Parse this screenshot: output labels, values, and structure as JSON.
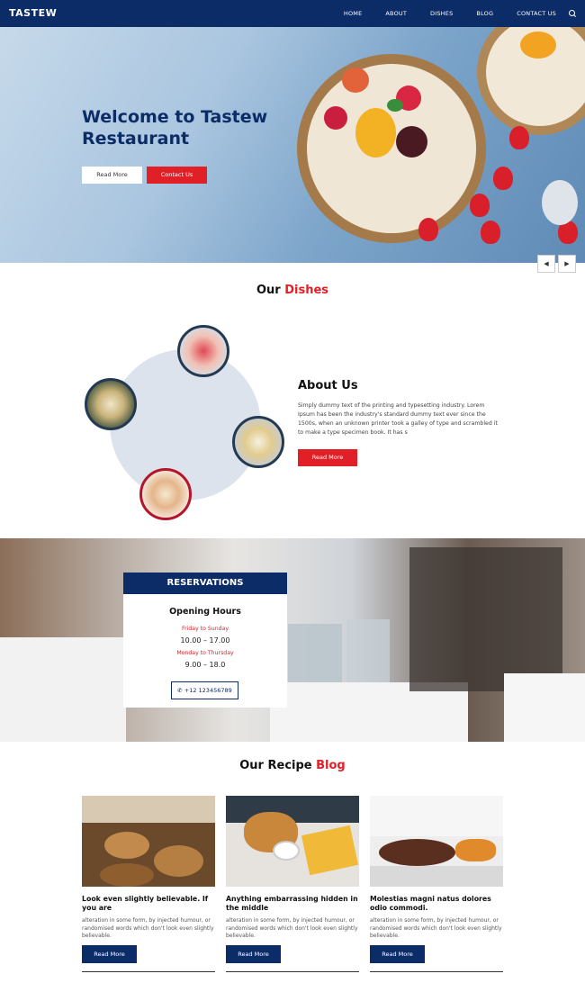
{
  "brand": "TASTEW",
  "nav": {
    "items": [
      "HOME",
      "ABOUT",
      "DISHES",
      "BLOG",
      "CONTACT US"
    ],
    "search_icon": "search-icon"
  },
  "hero": {
    "title": "Welcome to Tastew Restaurant",
    "btn_read_more": "Read More",
    "btn_contact": "Contact Us",
    "prev_icon": "arrow-left-icon",
    "next_icon": "arrow-right-icon"
  },
  "dishes": {
    "title_1": "Our ",
    "title_2": "Dishes"
  },
  "about": {
    "title": "About Us",
    "text": "Simply dummy text of the printing and typesetting industry. Lorem Ipsum has been the industry's standard dummy text ever since the 1500s, when an unknown printer took a galley of type and scrambled it to make a type specimen book. It has s",
    "button": "Read More"
  },
  "reservations": {
    "header": "RESERVATIONS",
    "opening": "Opening Hours",
    "day1": "Friday to Sunday",
    "hours1": "10.00 – 17.00",
    "day2": "Monday to Thursday",
    "hours2": "9.00 – 18.0",
    "phone": "+12 123456789",
    "phone_icon": "phone-icon"
  },
  "blog": {
    "title_1": "Our Recipe ",
    "title_2": "Blog",
    "posts": [
      {
        "title": "Look even slightly believable. If you are",
        "text": "alteration in some form, by injected humour, or randomised words which don't look even slightly believable.",
        "button": "Read More"
      },
      {
        "title": "Anything embarrassing hidden in the middle",
        "text": "alteration in some form, by injected humour, or randomised words which don't look even slightly believable.",
        "button": "Read More"
      },
      {
        "title": "Molestias magni natus dolores odio commodi.",
        "text": "alteration in some form, by injected humour, or randomised words which don't look even slightly believable.",
        "button": "Read More"
      }
    ]
  },
  "colors": {
    "primary": "#0c2c67",
    "accent": "#e01f26"
  }
}
